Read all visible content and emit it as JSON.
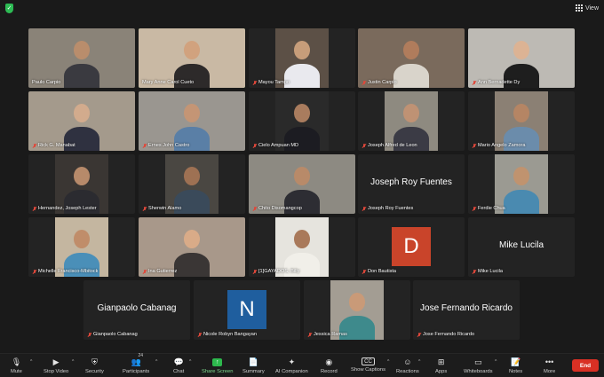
{
  "topbar": {
    "view_label": "View"
  },
  "participants": [
    {
      "name": "Paulo Carpio",
      "muted": false,
      "speaking": false,
      "video": "full",
      "bg": "#8a8378",
      "skin": "#b98d6c",
      "shirt": "#3a3a40"
    },
    {
      "name": "Mary Anne Carol Cueto",
      "muted": false,
      "speaking": true,
      "video": "full",
      "bg": "#c9b9a4",
      "skin": "#d1a27e",
      "shirt": "#2d2a2a"
    },
    {
      "name": "Mayou Tampo",
      "muted": true,
      "speaking": false,
      "video": "center",
      "bg": "#5c5046",
      "skin": "#c79d7a",
      "shirt": "#e9e9ee"
    },
    {
      "name": "Justin Carpio",
      "muted": true,
      "speaking": false,
      "video": "full",
      "bg": "#7a6a5c",
      "skin": "#b07c5c",
      "shirt": "#d9d4cb"
    },
    {
      "name": "Ann Bernadette Dy",
      "muted": true,
      "speaking": false,
      "video": "full",
      "bg": "#bdbab4",
      "skin": "#dcb394",
      "shirt": "#1e1e1e"
    },
    {
      "name": "Rick G. Manabat",
      "muted": true,
      "speaking": false,
      "video": "full",
      "bg": "#a49a8c",
      "skin": "#d2ab8d",
      "shirt": "#2f3140"
    },
    {
      "name": "Ernes John Castro",
      "muted": true,
      "speaking": false,
      "video": "full",
      "bg": "#9a9690",
      "skin": "#c49575",
      "shirt": "#5a7fa6"
    },
    {
      "name": "Cielo Ampuan MD",
      "muted": true,
      "speaking": false,
      "video": "center",
      "bg": "#2a2a2a",
      "skin": "#a97c5e",
      "shirt": "#1c1c22"
    },
    {
      "name": "Joseph Alfred de Leon",
      "muted": true,
      "speaking": false,
      "video": "center",
      "bg": "#8e8a80",
      "skin": "#bf9274",
      "shirt": "#3b3b45"
    },
    {
      "name": "Mario Angelo Zamora",
      "muted": true,
      "speaking": false,
      "video": "center",
      "bg": "#8b8074",
      "skin": "#b58564",
      "shirt": "#6b8cab"
    },
    {
      "name": "Hernandez, Joseph Lester",
      "muted": true,
      "speaking": false,
      "video": "center",
      "bg": "#3a3633",
      "skin": "#b78a6a",
      "shirt": "#2b2b30"
    },
    {
      "name": "Sherwin Alamo",
      "muted": true,
      "speaking": false,
      "video": "center",
      "bg": "#4a4742",
      "skin": "#9e7153",
      "shirt": "#3a4a5a"
    },
    {
      "name": "Chito Disomangcop",
      "muted": true,
      "speaking": false,
      "video": "full",
      "bg": "#8d8a82",
      "skin": "#b88a69",
      "shirt": "#2d2d33"
    },
    {
      "name": "Joseph Roy Fuentes",
      "muted": true,
      "speaking": false,
      "video": "none",
      "display": "Joseph Roy Fuentes"
    },
    {
      "name": "Ferdie Chua",
      "muted": true,
      "speaking": false,
      "video": "center",
      "bg": "#9b9a92",
      "skin": "#c0936f",
      "shirt": "#4a8ab0"
    },
    {
      "name": "Michelle Francisco-Mbitock",
      "muted": true,
      "speaking": false,
      "video": "center",
      "bg": "#c4b6a0",
      "skin": "#c08d6a",
      "shirt": "#4a8fb8"
    },
    {
      "name": "Ina Gutierrez",
      "muted": true,
      "speaking": false,
      "video": "full",
      "bg": "#a8988a",
      "skin": "#d9ab88",
      "shirt": "#3a3635"
    },
    {
      "name": "[1]GAYADOS, Billy",
      "muted": true,
      "speaking": false,
      "video": "center",
      "bg": "#e6e4de",
      "skin": "#a9795a",
      "shirt": "#f1efe9"
    },
    {
      "name": "Don Bautista",
      "muted": true,
      "speaking": false,
      "video": "avatar",
      "letter": "D",
      "avatar_color": "#c9442a"
    },
    {
      "name": "Mike Lucila",
      "muted": true,
      "speaking": false,
      "video": "none",
      "display": "Mike Lucila"
    },
    {
      "name": "Gianpaolo Cabanag",
      "muted": true,
      "speaking": false,
      "video": "none",
      "display": "Gianpaolo Cabanag"
    },
    {
      "name": "Nicole Robyn Bangayan",
      "muted": true,
      "speaking": false,
      "video": "avatar",
      "letter": "N",
      "avatar_color": "#1f5e9e"
    },
    {
      "name": "Jessica Ramas",
      "muted": true,
      "speaking": false,
      "video": "center",
      "bg": "#a39d93",
      "skin": "#c99a78",
      "shirt": "#3e8a8c"
    },
    {
      "name": "Jose Fernando Ricardo",
      "muted": true,
      "speaking": false,
      "video": "none",
      "display": "Jose Fernando Ricardo"
    }
  ],
  "toolbar": {
    "mute": "Mute",
    "stop_video": "Stop Video",
    "security": "Security",
    "participants": "Participants",
    "participants_count": "24",
    "chat": "Chat",
    "share_screen": "Share Screen",
    "summary": "Summary",
    "ai_companion": "AI Companion",
    "record": "Record",
    "show_captions": "Show Captions",
    "reactions": "Reactions",
    "apps": "Apps",
    "whiteboards": "Whiteboards",
    "notes": "Notes",
    "more": "More",
    "end": "End"
  }
}
